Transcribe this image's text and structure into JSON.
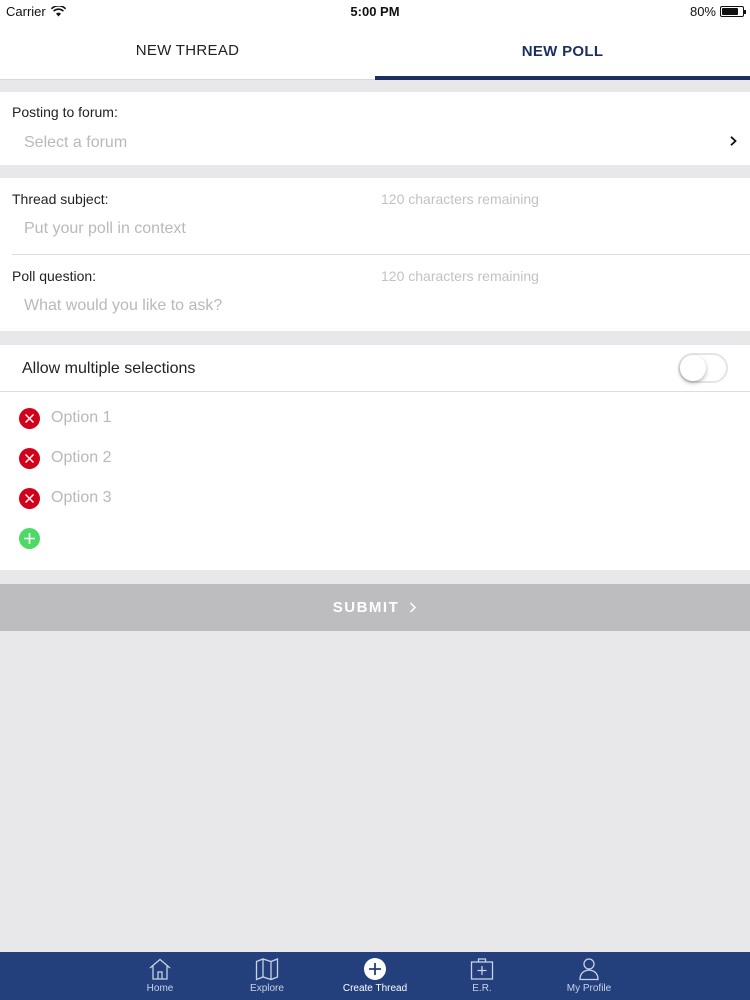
{
  "status_bar": {
    "carrier": "Carrier",
    "time": "5:00 PM",
    "battery": "80%",
    "battery_level": 0.8
  },
  "tabs": [
    {
      "label": "NEW THREAD",
      "active": false
    },
    {
      "label": "NEW POLL",
      "active": true
    }
  ],
  "forum": {
    "label": "Posting to forum:",
    "placeholder": "Select a forum"
  },
  "subject": {
    "label": "Thread subject:",
    "remaining": "120 characters remaining",
    "placeholder": "Put your poll in context"
  },
  "question": {
    "label": "Poll question:",
    "remaining": "120 characters remaining",
    "placeholder": "What would you like to ask?"
  },
  "multiple": {
    "label": "Allow multiple selections",
    "enabled": false
  },
  "options": [
    {
      "placeholder": "Option 1"
    },
    {
      "placeholder": "Option 2"
    },
    {
      "placeholder": "Option 3"
    }
  ],
  "submit": {
    "label": "SUBMIT"
  },
  "colors": {
    "accent": "#1c2f5e",
    "nav_bg": "#24407c",
    "remove": "#d0021b",
    "add": "#4cd964",
    "submit_bg": "#bdbcbf"
  },
  "bottom_nav": [
    {
      "label": "Home",
      "icon": "home-icon"
    },
    {
      "label": "Explore",
      "icon": "map-icon"
    },
    {
      "label": "Create Thread",
      "icon": "plus-circle-icon"
    },
    {
      "label": "E.R.",
      "icon": "medical-kit-icon"
    },
    {
      "label": "My Profile",
      "icon": "person-icon"
    }
  ]
}
